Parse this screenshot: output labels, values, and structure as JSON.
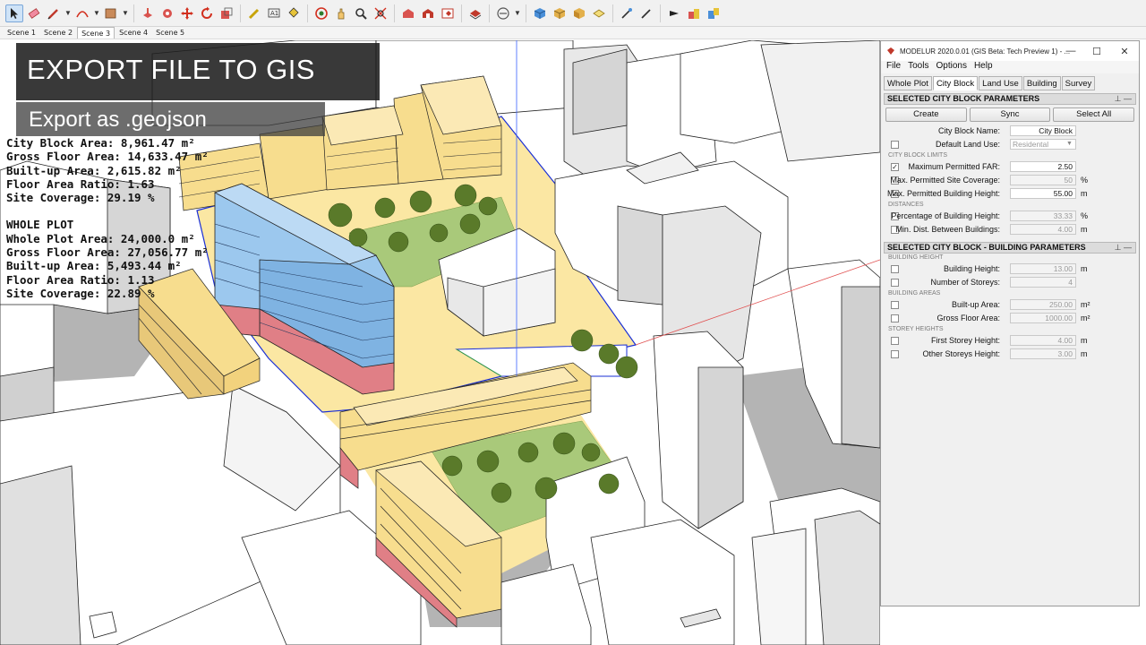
{
  "toolbar": {
    "icons": [
      "select-icon",
      "eraser-icon",
      "pencil-icon",
      "arc-icon",
      "rectangle-icon",
      "push-pull-icon",
      "follow-me-icon",
      "move-icon",
      "rotate-icon",
      "scale-icon",
      "tape-measure-icon",
      "text-icon",
      "paint-bucket-icon",
      "orbit-icon",
      "pan-icon",
      "zoom-icon",
      "zoom-extents-icon",
      "warehouse-icon",
      "extension-icon",
      "ruby-icon",
      "layers-icon",
      "section-icon",
      "iso-icon",
      "top-icon",
      "front-icon",
      "right-icon",
      "eyedropper-icon",
      "brush-icon",
      "arrow-icon",
      "modelur-icon",
      "export-icon"
    ]
  },
  "scenes": [
    "Scene 1",
    "Scene 2",
    "Scene 3",
    "Scene 4",
    "Scene 5"
  ],
  "active_scene": "Scene 3",
  "overlay": {
    "title": "EXPORT FILE TO GIS",
    "subtitle": "Export as .geojson"
  },
  "stats": {
    "city_block": [
      "City Block Area: 8,961.47 m²",
      "Gross Floor Area: 14,633.47 m²",
      "Built-up Area: 2,615.82 m²",
      "Floor Area Ratio: 1.63",
      "Site Coverage: 29.19 %"
    ],
    "whole_plot_title": "WHOLE PLOT",
    "whole_plot": [
      "Whole Plot Area: 24,000.0 m²",
      "Gross Floor Area: 27,056.77 m²",
      "Built-up Area: 5,493.44 m²",
      "Floor Area Ratio: 1.13",
      "Site Coverage: 22.89 %"
    ]
  },
  "panel": {
    "window_title": "MODELUR 2020.0.01 (GIS Beta: Tech Preview 1) - ...",
    "controls": {
      "minimize": "—",
      "maximize": "☐",
      "close": "✕"
    },
    "menu": [
      "File",
      "Tools",
      "Options",
      "Help"
    ],
    "tabs": [
      "Whole Plot",
      "City Block",
      "Land Use",
      "Building",
      "Survey"
    ],
    "active_tab": "City Block",
    "section1": {
      "title": "SELECTED CITY BLOCK PARAMETERS",
      "buttons": [
        "Create",
        "Sync",
        "Select All"
      ],
      "name_label": "City Block Name:",
      "name_value": "City Block",
      "land_use_label": "Default Land Use:",
      "land_use_value": "Residental",
      "limits_group": "CITY BLOCK LIMITS",
      "far_label": "Maximum Permitted FAR:",
      "far_value": "2.50",
      "coverage_label": "Max. Permitted Site Coverage:",
      "coverage_value": "50",
      "coverage_unit": "%",
      "height_label": "Max. Permitted Building Height:",
      "height_value": "55.00",
      "height_unit": "m",
      "distances_group": "DISTANCES",
      "pct_label": "Percentage of Building Height:",
      "pct_value": "33.33",
      "pct_unit": "%",
      "min_label": "Min. Dist. Between Buildings:",
      "min_value": "4.00",
      "min_unit": "m"
    },
    "section2": {
      "title": "SELECTED CITY BLOCK - BUILDING PARAMETERS",
      "height_group": "BUILDING HEIGHT",
      "bh_label": "Building Height:",
      "bh_value": "13.00",
      "bh_unit": "m",
      "ns_label": "Number of Storeys:",
      "ns_value": "4",
      "areas_group": "BUILDING AREAS",
      "bu_label": "Built-up Area:",
      "bu_value": "250.00",
      "bu_unit": "m²",
      "gfa_label": "Gross Floor Area:",
      "gfa_value": "1000.00",
      "gfa_unit": "m²",
      "storey_group": "STOREY HEIGHTS",
      "fs_label": "First Storey Height:",
      "fs_value": "4.00",
      "fs_unit": "m",
      "os_label": "Other Storeys Height:",
      "os_value": "3.00",
      "os_unit": "m"
    }
  },
  "colors": {
    "building_white": "#ffffff",
    "building_shadow": "#b9b9b9",
    "residential_yellow": "#f7dd8e",
    "highlight_blue": "#9cc8ee",
    "ground_red": "#e07f86",
    "plot_yellow": "#fbe7a3",
    "park_green": "#a9c97a",
    "boundary_blue": "#1a2fd6"
  }
}
